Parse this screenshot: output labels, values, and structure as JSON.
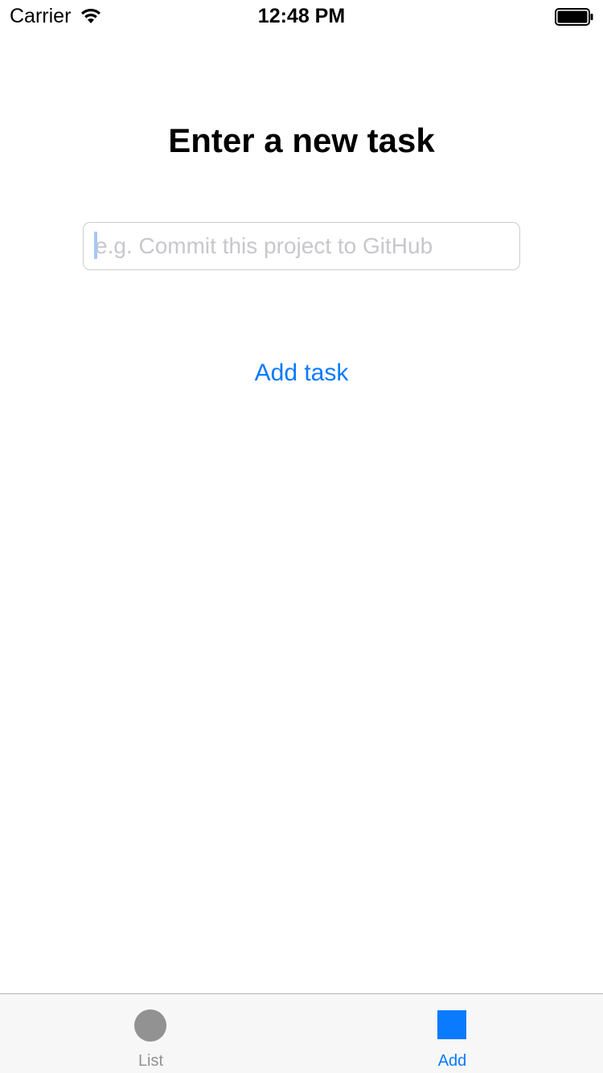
{
  "status_bar": {
    "carrier": "Carrier",
    "time": "12:48 PM",
    "wifi_icon": "wifi-icon",
    "battery_icon": "battery-full-icon"
  },
  "main": {
    "title": "Enter a new task",
    "task_input": {
      "value": "",
      "placeholder": "e.g. Commit this project to GitHub"
    },
    "add_button_label": "Add task"
  },
  "tab_bar": {
    "tabs": [
      {
        "label": "List",
        "icon": "circle-icon",
        "selected": false
      },
      {
        "label": "Add",
        "icon": "square-icon",
        "selected": true
      }
    ]
  },
  "colors": {
    "accent": "#0a7aff",
    "inactive_tab": "#929292",
    "placeholder": "#c7c7cd"
  }
}
